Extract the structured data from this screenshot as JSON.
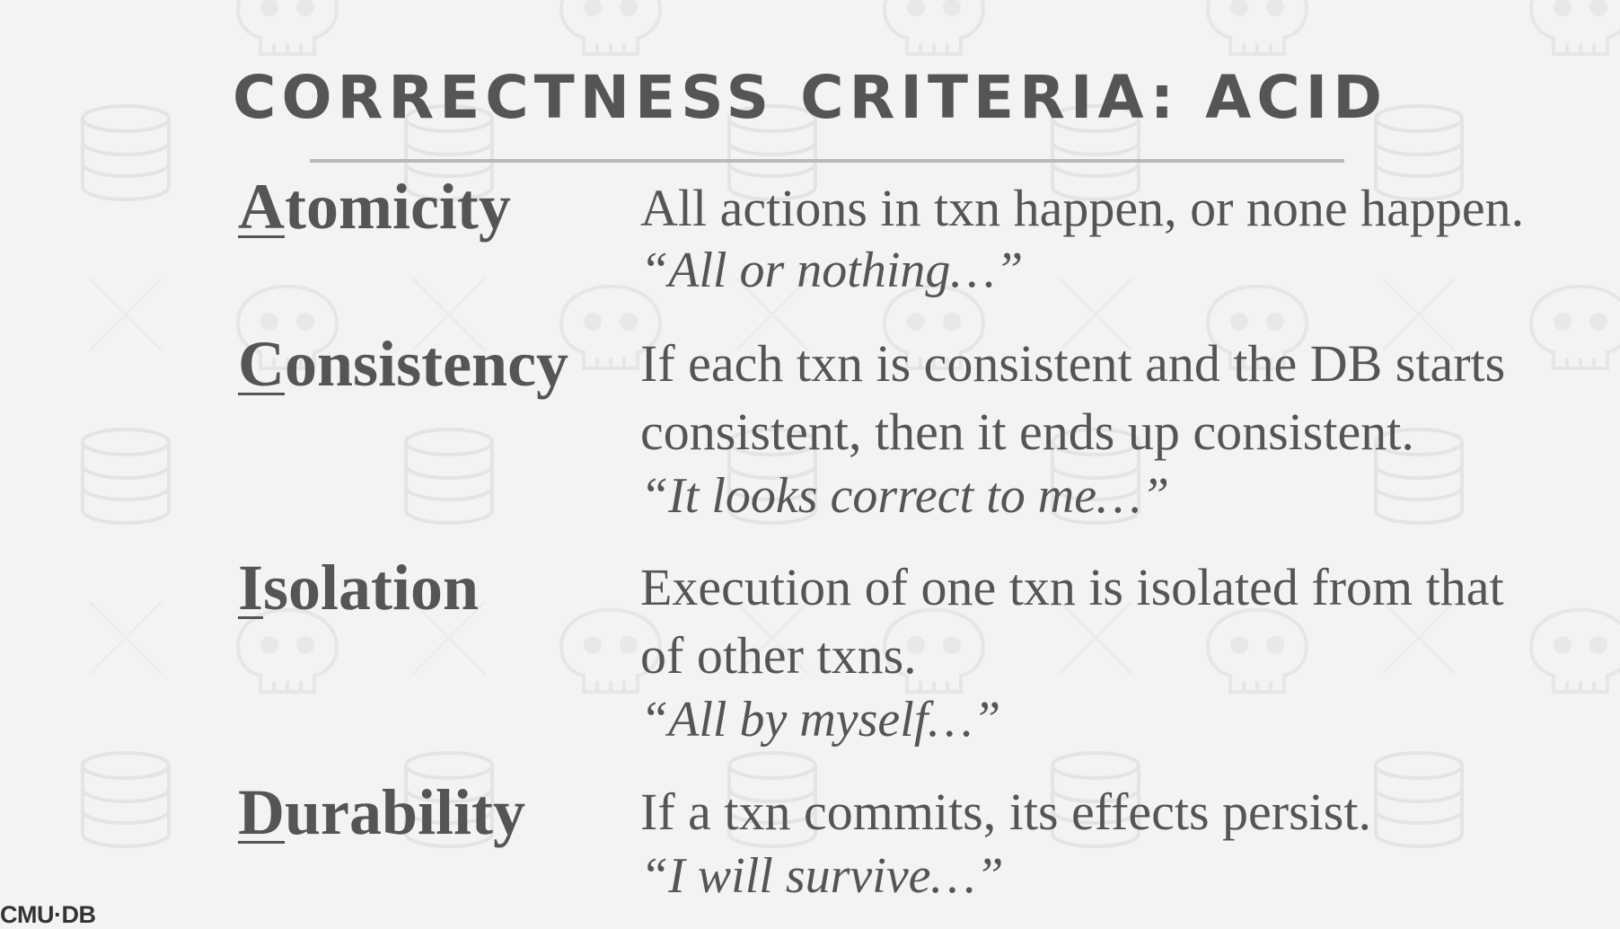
{
  "title": "CORRECTNESS CRITERIA: ACID",
  "properties": [
    {
      "first_letter": "A",
      "rest": "tomicity",
      "lines": [
        "All actions in txn happen, or none happen."
      ],
      "quote": "“All or nothing…”"
    },
    {
      "first_letter": "C",
      "rest": "onsistency",
      "lines": [
        "If each txn is consistent and the DB starts",
        "consistent, then it ends up consistent."
      ],
      "quote": "“It looks correct to me…”"
    },
    {
      "first_letter": "I",
      "rest": "solation",
      "lines": [
        "Execution of one txn is isolated from that",
        "of other txns."
      ],
      "quote": "“All by myself…”"
    },
    {
      "first_letter": "D",
      "rest": "urability",
      "lines": [
        "If a txn commits, its effects persist."
      ],
      "quote": "“I will survive…”"
    }
  ],
  "footer": {
    "logo_text": "CMU·DB"
  },
  "colors": {
    "background": "#f3f3f3",
    "text": "#555555",
    "rule": "#b9b9b9",
    "pattern": "#e6e6e6"
  },
  "icons": {
    "background_pattern": [
      "database-icon",
      "skull-icon"
    ]
  }
}
